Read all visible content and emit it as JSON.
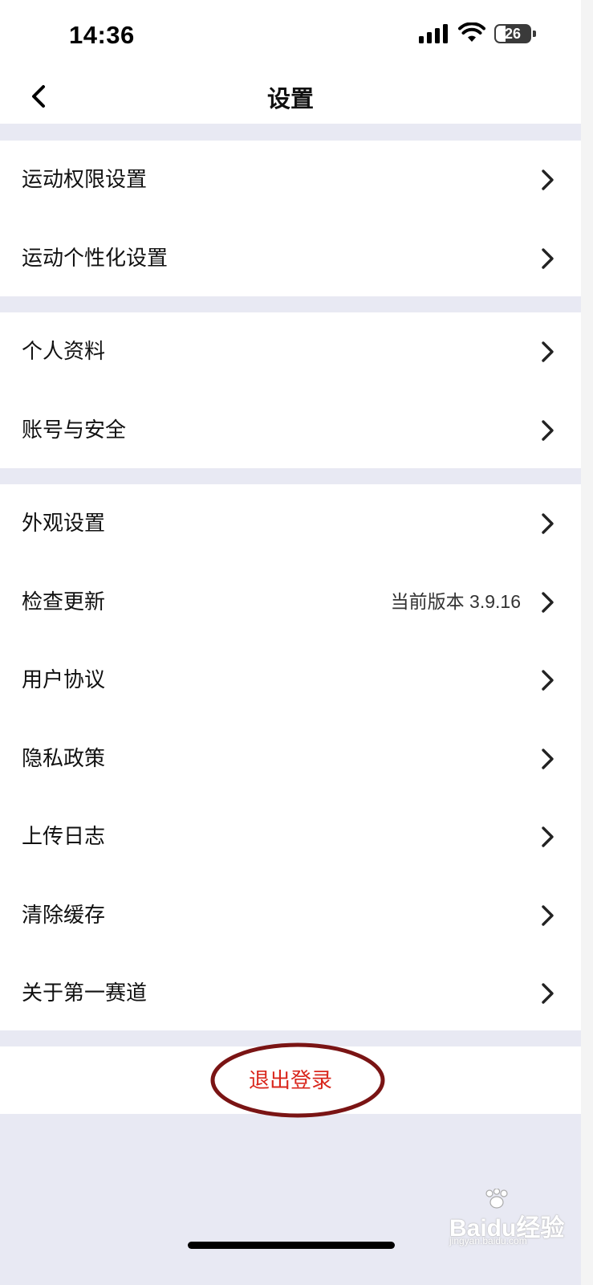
{
  "status_bar": {
    "time": "14:36",
    "battery": "26"
  },
  "nav": {
    "title": "设置"
  },
  "groups": [
    {
      "items": [
        {
          "label": "运动权限设置"
        },
        {
          "label": "运动个性化设置"
        }
      ]
    },
    {
      "items": [
        {
          "label": "个人资料"
        },
        {
          "label": "账号与安全"
        }
      ]
    },
    {
      "items": [
        {
          "label": "外观设置"
        },
        {
          "label": "检查更新",
          "value": "当前版本 3.9.16"
        },
        {
          "label": "用户协议"
        },
        {
          "label": "隐私政策"
        },
        {
          "label": "上传日志"
        },
        {
          "label": "清除缓存"
        },
        {
          "label": "关于第一赛道"
        }
      ]
    }
  ],
  "logout": {
    "label": "退出登录"
  },
  "watermark": {
    "text": "Baidu经验",
    "url": "jingyan.baidu.com"
  },
  "colors": {
    "background": "#e8e9f3",
    "logout_text": "#d9261c",
    "annotation_circle": "#7a1414"
  },
  "icons": {
    "back": "chevron-left-icon",
    "row_arrow": "chevron-right-icon"
  }
}
